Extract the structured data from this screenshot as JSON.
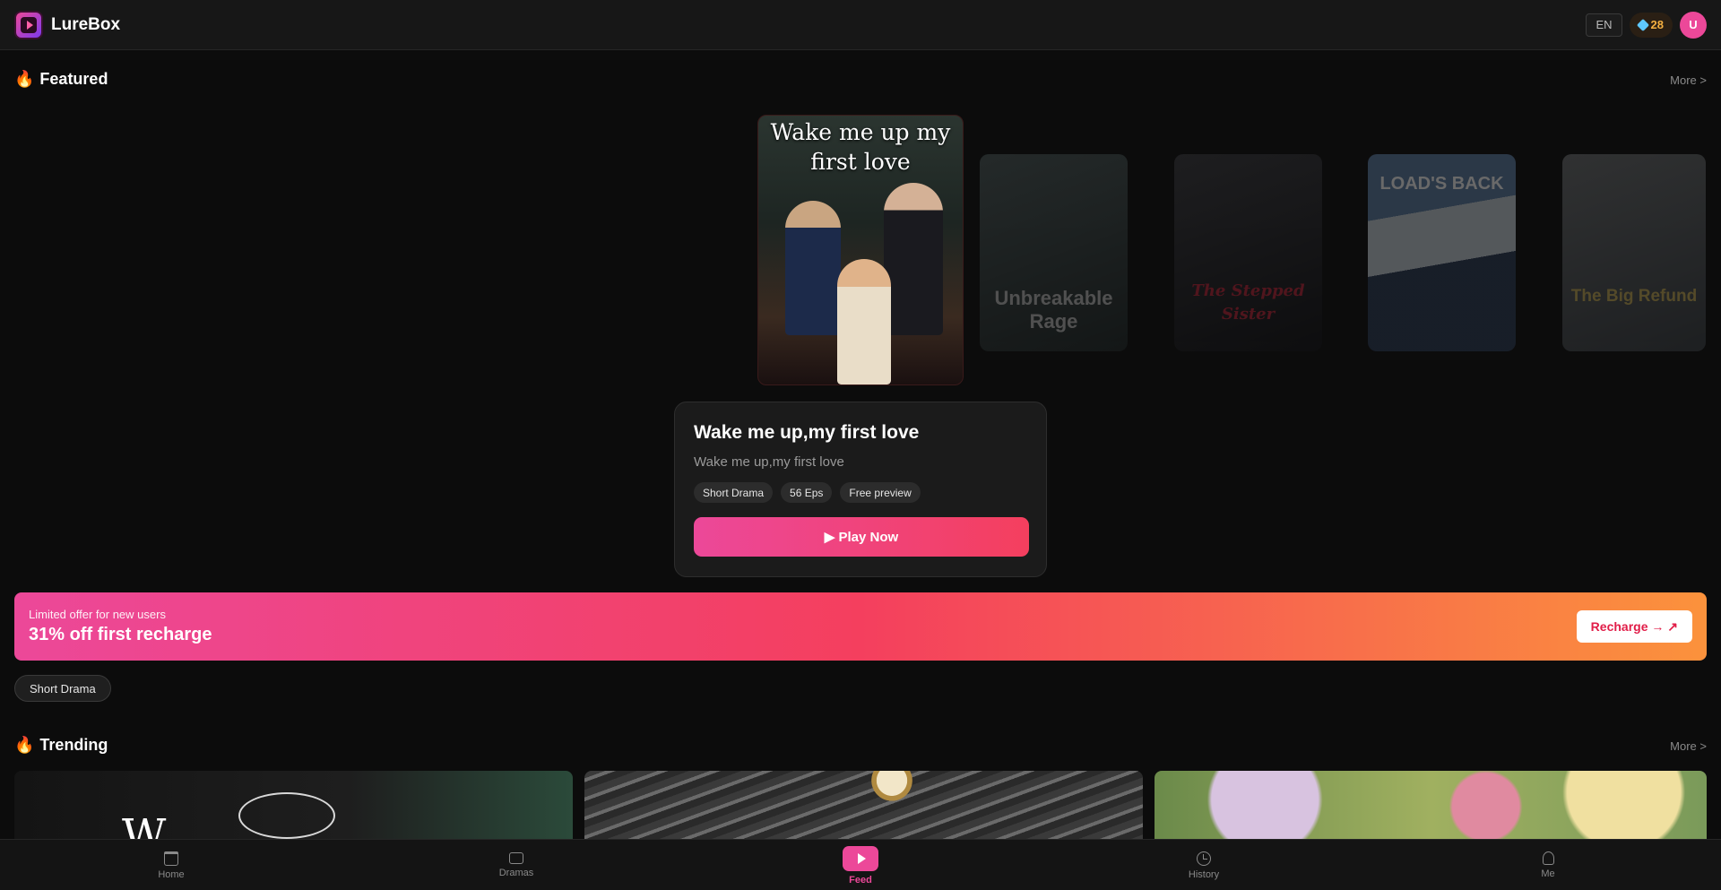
{
  "header": {
    "brand": "LureBox",
    "language": "EN",
    "coins": "28",
    "avatar_initial": "U"
  },
  "featured": {
    "title": "Featured",
    "more": "More >",
    "main_poster_text": "Wake me up my first love",
    "side_posters": [
      {
        "text": "Unbreakable Rage"
      },
      {
        "text": "The Stepped Sister"
      },
      {
        "text": "LOAD'S BACK"
      },
      {
        "text": "The Big Refund"
      }
    ]
  },
  "info_card": {
    "title": "Wake me up,my first love",
    "subtitle": "Wake me up,my first love",
    "tags": [
      "Short Drama",
      "56 Eps",
      "Free preview"
    ],
    "play_label": "▶ Play Now"
  },
  "promo": {
    "small": "Limited offer for new users",
    "big": "31% off first recharge",
    "button": "Recharge → ↗"
  },
  "category_chip": "Short Drama",
  "trending": {
    "title": "Trending",
    "more": "More >",
    "thumb_letter": "W"
  },
  "nav": {
    "home": "Home",
    "dramas": "Dramas",
    "feed": "Feed",
    "history": "History",
    "me": "Me"
  },
  "colors": {
    "accent": "#ec4899",
    "accent_end": "#f43f5e",
    "promo_end": "#fb923c",
    "coin": "#f5b041"
  }
}
